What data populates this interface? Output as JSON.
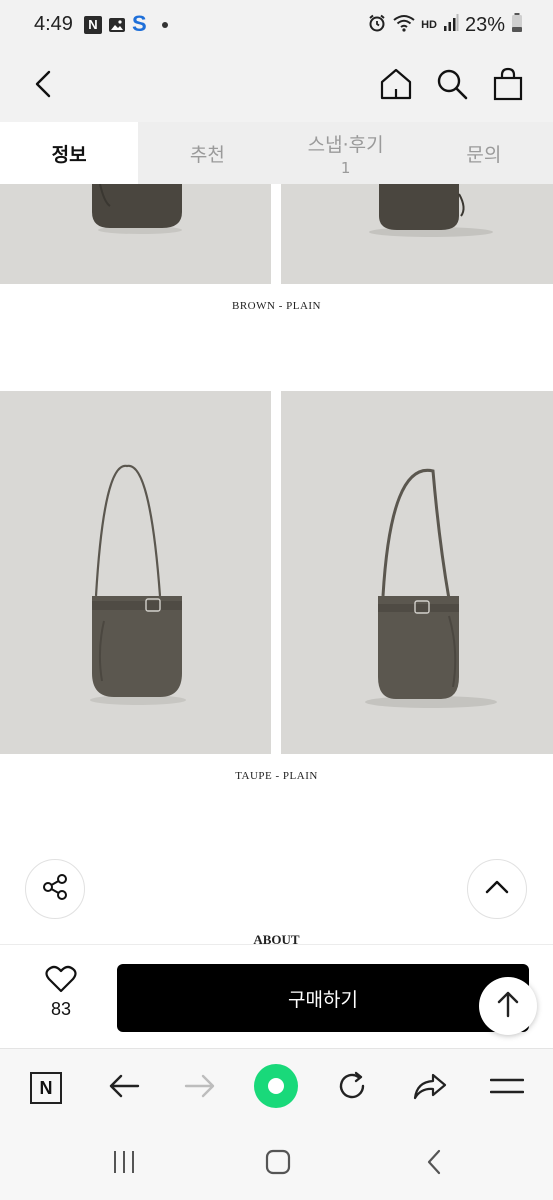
{
  "status_bar": {
    "time": "4:49",
    "notif_n": "N",
    "notif_s": "S",
    "network_label": "HD",
    "battery": "23%"
  },
  "header": {
    "back_icon": "chevron-left-icon",
    "home_icon": "home-icon",
    "search_icon": "search-icon",
    "cart_icon": "shopping-bag-icon"
  },
  "tabs": [
    {
      "label": "정보",
      "active": true
    },
    {
      "label": "추천",
      "active": false
    },
    {
      "label": "스냅·후기",
      "count": "1",
      "active": false
    },
    {
      "label": "문의",
      "active": false
    }
  ],
  "product_sections": [
    {
      "caption": "BROWN - PLAIN",
      "bag_color": "#4a463f"
    },
    {
      "caption": "TAUPE - PLAIN",
      "bag_color": "#5b574f"
    }
  ],
  "about_heading": "ABOUT",
  "purchase_bar": {
    "like_count": "83",
    "buy_label": "구매하기"
  },
  "browser_toolbar": {
    "n_label": "N",
    "accent_color": "#19d97a"
  },
  "colors": {
    "photo_bg": "#d9d8d5",
    "button_bg": "#000000"
  }
}
